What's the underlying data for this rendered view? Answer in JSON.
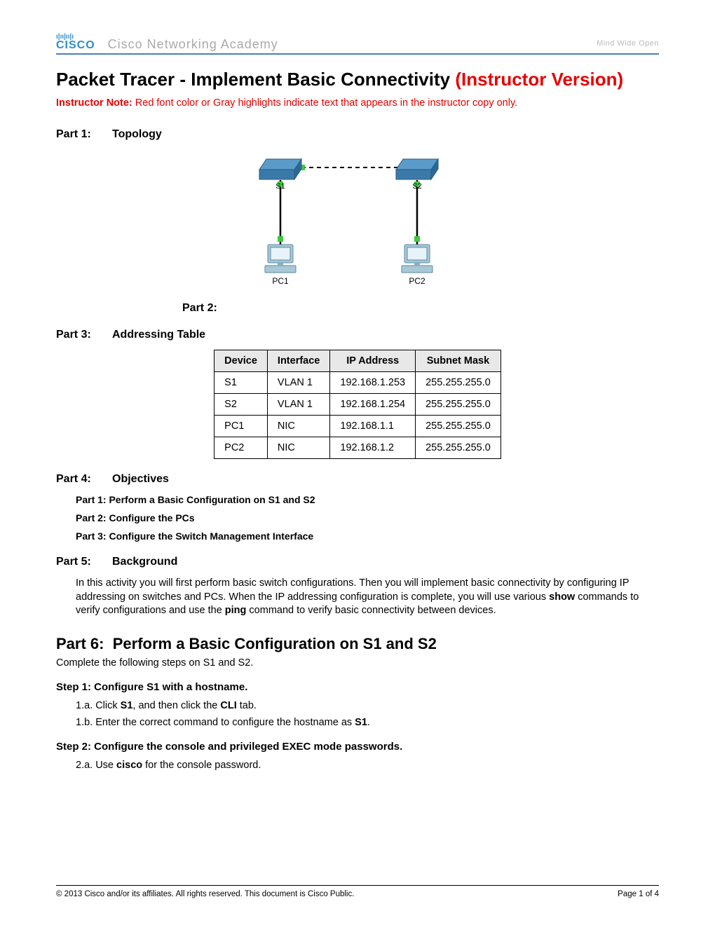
{
  "header": {
    "logo_bars": "ı|ıı|ıı|ı",
    "logo_text": "CISCO",
    "academy": "Cisco Networking Academy",
    "tagline": "Mind Wide Open"
  },
  "title": {
    "black": "Packet Tracer - Implement Basic Connectivity ",
    "red": "(Instructor Version)"
  },
  "instructor_note": {
    "label": "Instructor Note:",
    "text": " Red font color or Gray highlights indicate text that appears in the instructor copy only."
  },
  "parts": {
    "p1_label": "Part 1:",
    "p1_text": "Topology",
    "p2_label": "Part 2:",
    "p3_label": "Part 3:",
    "p3_text": "Addressing Table",
    "p4_label": "Part 4:",
    "p4_text": "Objectives",
    "p5_label": "Part 5:",
    "p5_text": "Background",
    "p6_label": "Part 6:",
    "p6_text": "Perform a Basic Configuration on S1 and S2"
  },
  "topology": {
    "s1_label": "S1",
    "s2_label": "S2",
    "pc1_label": "PC1",
    "pc2_label": "PC2"
  },
  "table": {
    "headers": {
      "device": "Device",
      "interface": "Interface",
      "ip": "IP Address",
      "mask": "Subnet Mask"
    },
    "rows": [
      {
        "device": "S1",
        "interface": "VLAN 1",
        "ip": "192.168.1.253",
        "mask": "255.255.255.0"
      },
      {
        "device": "S2",
        "interface": "VLAN 1",
        "ip": "192.168.1.254",
        "mask": "255.255.255.0"
      },
      {
        "device": "PC1",
        "interface": "NIC",
        "ip": "192.168.1.1",
        "mask": "255.255.255.0"
      },
      {
        "device": "PC2",
        "interface": "NIC",
        "ip": "192.168.1.2",
        "mask": "255.255.255.0"
      }
    ]
  },
  "objectives": {
    "o1": "Part 1: Perform a Basic Configuration on S1 and S2",
    "o2": "Part 2: Configure the PCs",
    "o3": "Part 3: Configure the Switch Management Interface"
  },
  "background": {
    "t1": "In this activity you will first perform basic switch configurations. Then you will implement basic connectivity by configuring IP addressing on switches and PCs. When the IP addressing configuration is complete, you will use various ",
    "b1": "show",
    "t2": " commands to verify configurations and use the ",
    "b2": "ping",
    "t3": " command to verify basic connectivity between devices."
  },
  "part6_sub": "Complete the following steps on S1 and S2.",
  "step1": {
    "heading": "Step 1:   Configure S1 with a hostname.",
    "a_pre": "1.a. Click ",
    "a_b1": "S1",
    "a_mid": ", and then click the ",
    "a_b2": "CLI",
    "a_post": " tab.",
    "b_pre": "1.b. Enter the correct command to configure the hostname as ",
    "b_b1": "S1",
    "b_post": "."
  },
  "step2": {
    "heading": "Step 2:   Configure the console and privileged EXEC mode passwords.",
    "a_pre": "2.a. Use ",
    "a_b1": "cisco",
    "a_post": " for the console password."
  },
  "footer": {
    "copyright": "© 2013 Cisco and/or its affiliates. All rights reserved. This document is Cisco Public.",
    "page": "Page 1 of 4"
  }
}
